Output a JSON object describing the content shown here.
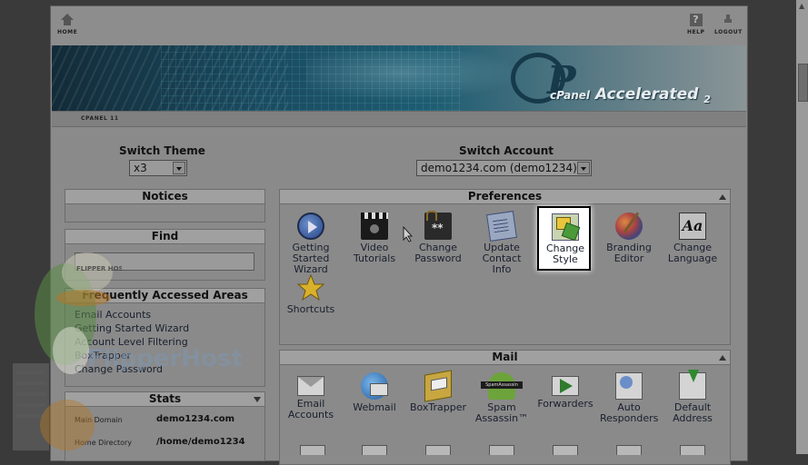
{
  "topbar": {
    "home_label": "HOME",
    "help_label": "HELP",
    "logout_label": "LOGOUT",
    "help_glyph": "?"
  },
  "banner": {
    "logo_letter": "P",
    "brand_prefix": "cPanel",
    "brand_name": "Accelerated",
    "brand_suffix": "2"
  },
  "version_label": "CPANEL 11",
  "switch_theme": {
    "title": "Switch Theme",
    "value": "x3"
  },
  "switch_account": {
    "title": "Switch Account",
    "value": "demo1234.com (demo1234)"
  },
  "sidebar": {
    "notices_title": "Notices",
    "find_title": "Find",
    "find_value": "",
    "faa_title": "Frequently Accessed Areas",
    "faa_links": [
      "Email Accounts",
      "Getting Started Wizard",
      "Account Level Filtering",
      "BoxTrapper",
      "Change Password"
    ],
    "stats_title": "Stats",
    "stats": [
      {
        "label": "Main Domain",
        "value": "demo1234.com"
      },
      {
        "label": "Home Directory",
        "value": "/home/demo1234"
      }
    ]
  },
  "preferences": {
    "title": "Preferences",
    "items": [
      {
        "lines": [
          "Getting",
          "Started",
          "Wizard"
        ],
        "icon": "play-icon"
      },
      {
        "lines": [
          "Video",
          "Tutorials"
        ],
        "icon": "clapperboard-icon"
      },
      {
        "lines": [
          "Change",
          "Password"
        ],
        "icon": "password-icon"
      },
      {
        "lines": [
          "Update",
          "Contact",
          "Info"
        ],
        "icon": "contact-info-icon"
      },
      {
        "lines": [
          "Change",
          "Style"
        ],
        "icon": "style-icon",
        "highlighted": true
      },
      {
        "lines": [
          "Branding",
          "Editor"
        ],
        "icon": "palette-icon"
      },
      {
        "lines": [
          "Change",
          "Language"
        ],
        "icon": "language-icon"
      },
      {
        "lines": [
          "Shortcuts"
        ],
        "icon": "star-icon"
      }
    ]
  },
  "mail": {
    "title": "Mail",
    "items": [
      {
        "lines": [
          "Email",
          "Accounts"
        ],
        "icon": "envelope-icon"
      },
      {
        "lines": [
          "Webmail"
        ],
        "icon": "globe-mail-icon"
      },
      {
        "lines": [
          "BoxTrapper"
        ],
        "icon": "boxtrapper-icon"
      },
      {
        "lines": [
          "Spam",
          "Assassin™"
        ],
        "icon": "spamassassin-icon"
      },
      {
        "lines": [
          "Forwarders"
        ],
        "icon": "forward-icon"
      },
      {
        "lines": [
          "Auto",
          "Responders"
        ],
        "icon": "autoresponder-icon"
      },
      {
        "lines": [
          "Default",
          "Address"
        ],
        "icon": "default-address-icon"
      }
    ]
  },
  "watermark": {
    "badge_text": "FLIPPER HOST",
    "brand_text": "FlipperHost"
  },
  "colors": {
    "accent_highlight": "#ffffff",
    "banner_dark": "#132b38",
    "text": "#1a1f2e"
  }
}
